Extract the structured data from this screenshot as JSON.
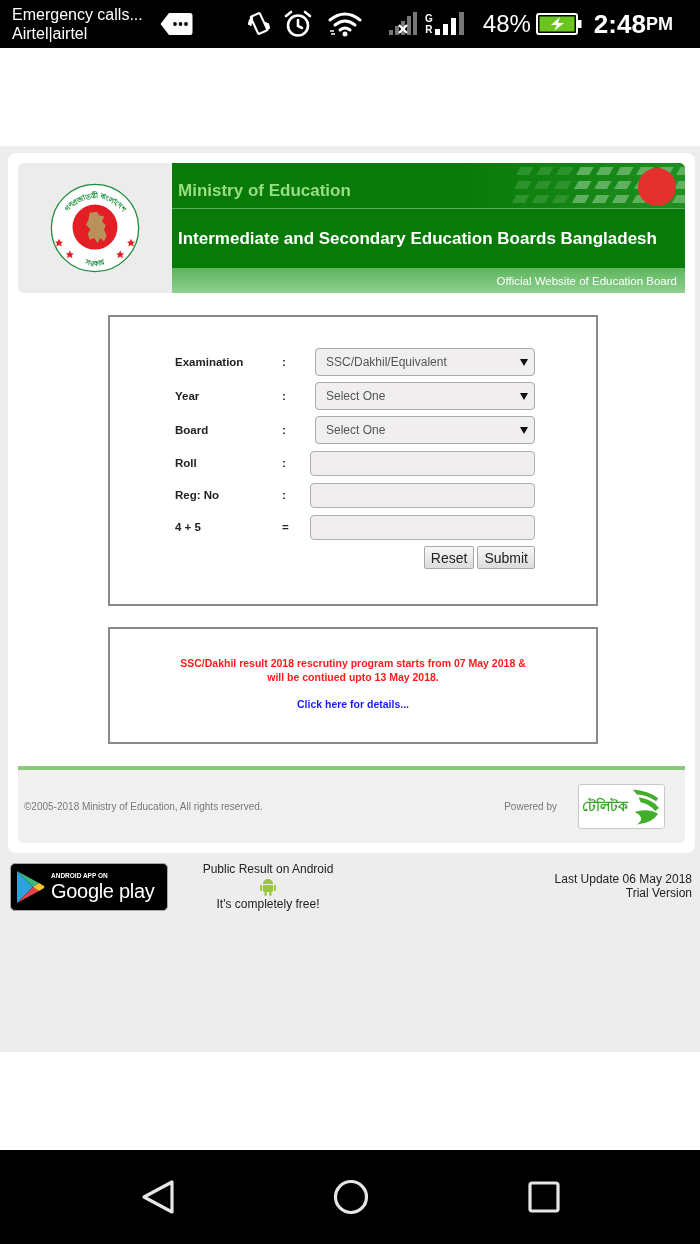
{
  "status_bar": {
    "notification_lines": [
      "Emergency calls...",
      "Airtel|airtel"
    ],
    "network_type": "G",
    "roaming": "R",
    "battery": "48%",
    "time": "2:48",
    "time_suffix": "PM"
  },
  "header": {
    "emblem": {
      "upper_text": "গণপ্রজাতন্ত্রী বাংলাদেশ",
      "lower_text": "সরকার"
    },
    "ministry": "Ministry of Education",
    "title": "Intermediate and Secondary Education Boards Bangladesh",
    "tagline": "Official Website of Education Board"
  },
  "form": {
    "fields": [
      {
        "label": "Examination",
        "separator": ":",
        "kind": "select",
        "value": "SSC/Dakhil/Equivalent"
      },
      {
        "label": "Year",
        "separator": ":",
        "kind": "select",
        "value": "Select One"
      },
      {
        "label": "Board",
        "separator": ":",
        "kind": "select",
        "value": "Select One"
      },
      {
        "label": "Roll",
        "separator": ":",
        "kind": "text"
      },
      {
        "label": "Reg: No",
        "separator": ":",
        "kind": "text"
      },
      {
        "label": "4 + 5",
        "separator": "=",
        "kind": "text"
      }
    ],
    "buttons": [
      "Reset",
      "Submit"
    ]
  },
  "notice": {
    "message_lines": [
      "SSC/Dakhil result 2018 rescrutiny program starts from 07 May 2018 &",
      "will be contiued upto 13 May 2018."
    ],
    "link": "Click here for details..."
  },
  "footer": {
    "copyright": "©2005-2018 Ministry of Education, All rights reserved.",
    "powered_by": "Powered by",
    "sponsor_logo_text": "টেলিটক"
  },
  "app_promo": {
    "badge_small": "ANDROID APP ON",
    "badge_large": "Google play",
    "title": "Public Result on Android",
    "subtitle": "It's completely free!"
  },
  "update_info": {
    "last_update": "Last Update 06 May 2018",
    "version": "Trial Version"
  }
}
